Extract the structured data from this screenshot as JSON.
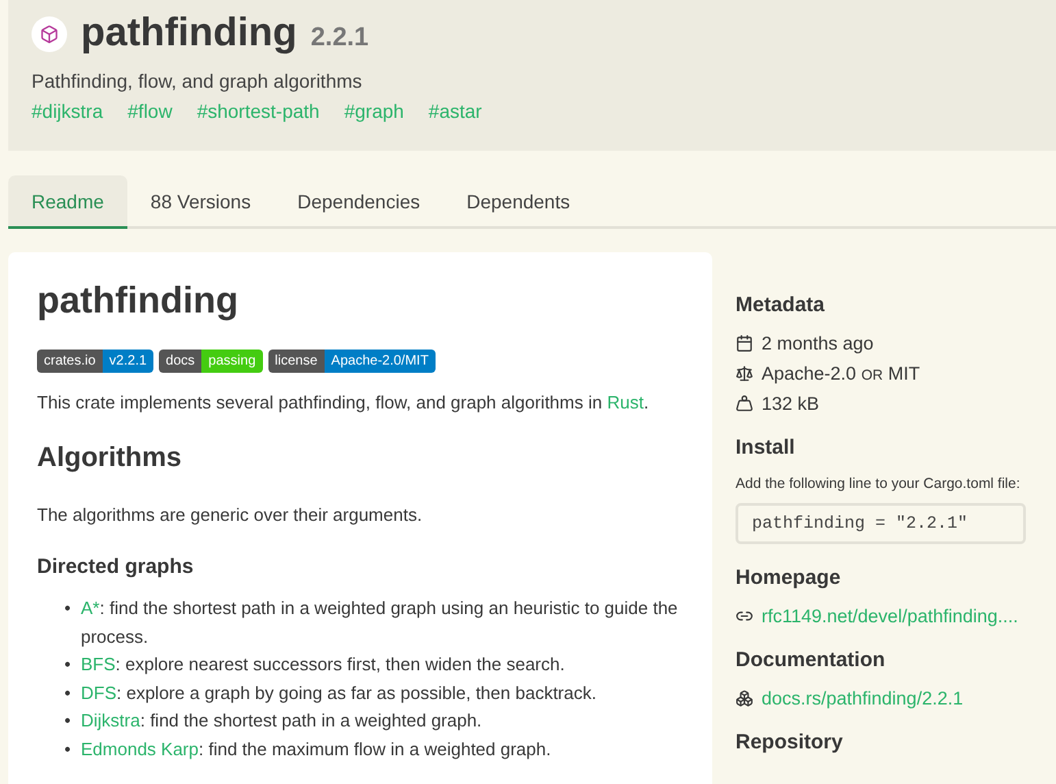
{
  "header": {
    "name": "pathfinding",
    "version": "2.2.1",
    "description": "Pathfinding, flow, and graph algorithms",
    "keywords": [
      "#dijkstra",
      "#flow",
      "#shortest-path",
      "#graph",
      "#astar"
    ]
  },
  "tabs": [
    {
      "label": "Readme",
      "selected": true
    },
    {
      "label": "88 Versions",
      "selected": false
    },
    {
      "label": "Dependencies",
      "selected": false
    },
    {
      "label": "Dependents",
      "selected": false
    }
  ],
  "readme": {
    "title": "pathfinding",
    "badges": [
      {
        "label": "crates.io",
        "value": "v2.2.1",
        "color": "#007ec6"
      },
      {
        "label": "docs",
        "value": "passing",
        "color": "#44cc11"
      },
      {
        "label": "license",
        "value": "Apache-2.0/MIT",
        "color": "#007ec6"
      }
    ],
    "intro": {
      "text": "This crate implements several pathfinding, flow, and graph algorithms in ",
      "link": "Rust",
      "after": "."
    },
    "heading": "Algorithms",
    "paragraph": "The algorithms are generic over their arguments.",
    "subheading": "Directed graphs",
    "items": [
      {
        "bullet": "•",
        "link": "A*",
        "text": ": find the shortest path in a weighted graph using an heuristic to guide the process."
      },
      {
        "bullet": "•",
        "link": "BFS",
        "text": ": explore nearest successors first, then widen the search."
      },
      {
        "bullet": "•",
        "link": "DFS",
        "text": ": explore a graph by going as far as possible, then backtrack."
      },
      {
        "bullet": "•",
        "link": "Dijkstra",
        "text": ": find the shortest path in a weighted graph."
      },
      {
        "bullet": "•",
        "link": "Edmonds Karp",
        "text": ": find the maximum flow in a weighted graph."
      }
    ]
  },
  "sidebar": {
    "metadata_title": "Metadata",
    "updated": "2 months ago",
    "license": [
      "Apache-2.0",
      "OR",
      "MIT"
    ],
    "size": "132 kB",
    "install_title": "Install",
    "install_hint": "Add the following line to your Cargo.toml file:",
    "install_code": "pathfinding = \"2.2.1\"",
    "homepage_title": "Homepage",
    "homepage": "rfc1149.net/devel/pathfinding....",
    "documentation_title": "Documentation",
    "documentation": "docs.rs/pathfinding/2.2.1",
    "repository_title": "Repository"
  }
}
